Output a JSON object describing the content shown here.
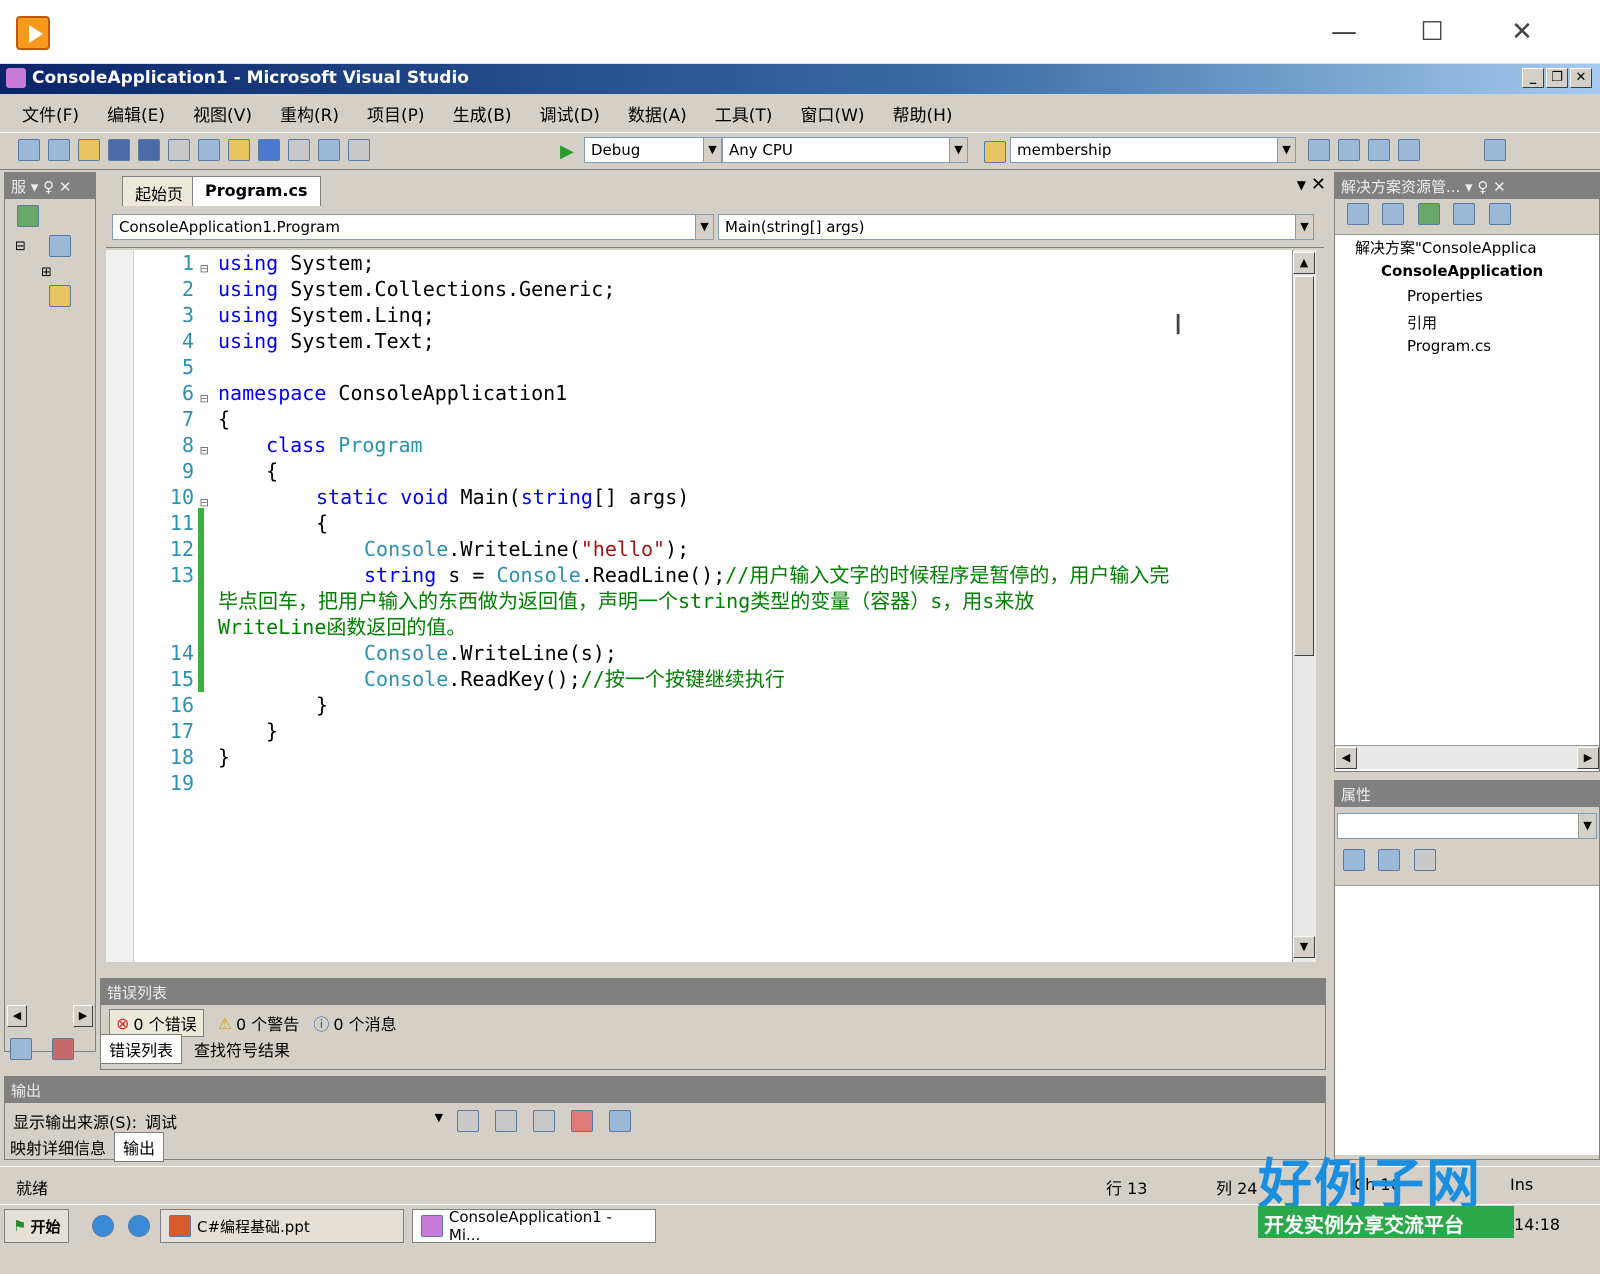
{
  "player": {
    "close_glyph": "✕",
    "max_glyph": "☐",
    "min_glyph": "—"
  },
  "window": {
    "title": "ConsoleApplication1 - Microsoft Visual Studio"
  },
  "menu": [
    "文件(F)",
    "编辑(E)",
    "视图(V)",
    "重构(R)",
    "项目(P)",
    "生成(B)",
    "调试(D)",
    "数据(A)",
    "工具(T)",
    "窗口(W)",
    "帮助(H)"
  ],
  "toolbar": {
    "config": "Debug",
    "platform": "Any CPU",
    "find_combo": "membership"
  },
  "left_panel": {
    "header": "服 ▾ ♀ ✕"
  },
  "tabs": {
    "start": "起始页",
    "active": "Program.cs"
  },
  "nav": {
    "type": "ConsoleApplication1.Program",
    "member": "Main(string[] args)"
  },
  "code": {
    "line_numbers": [
      "1",
      "2",
      "3",
      "4",
      "5",
      "6",
      "7",
      "8",
      "9",
      "10",
      "11",
      "12",
      "13",
      "",
      "",
      "14",
      "15",
      "16",
      "17",
      "18",
      "19"
    ],
    "l1a": "using",
    "l1b": " System;",
    "l2a": "using",
    "l2b": " System.Collections.Generic;",
    "l3a": "using",
    "l3b": " System.Linq;",
    "l4a": "using",
    "l4b": " System.Text;",
    "l6a": "namespace",
    "l6b": " ConsoleApplication1",
    "l7": "{",
    "l8a": "class",
    "l8b": " Program",
    "l9": "{",
    "l10a": "static",
    "l10b": " ",
    "l10c": "void",
    "l10d": " Main(",
    "l10e": "string",
    "l10f": "[] args)",
    "l11": "{",
    "l12a": "Console",
    "l12b": ".WriteLine(",
    "l12c": "\"hello\"",
    "l12d": ");",
    "l13a": "string",
    "l13b": " s = ",
    "l13c": "Console",
    "l13d": ".ReadLine();",
    "l13e": "//用户输入文字的时候程序是暂停的，用户输入完",
    "l13f": "毕点回车，把用户输入的东西做为返回值，声明一个string类型的变量（容器）s，用s来放",
    "l13g": "WriteLine函数返回的值。",
    "l14a": "Console",
    "l14b": ".WriteLine(s);",
    "l15a": "Console",
    "l15b": ".ReadKey();",
    "l15c": "//按一个按键继续执行",
    "l16": "}",
    "l17": "}",
    "l18": "}"
  },
  "solution_explorer": {
    "header": "解决方案资源管... ▾ ♀ ✕",
    "items": [
      "解决方案\"ConsoleApplica",
      "ConsoleApplication",
      "Properties",
      "引用",
      "Program.cs"
    ]
  },
  "properties": {
    "header": "属性"
  },
  "error_list": {
    "header": "错误列表",
    "errors": "0 个错误",
    "warnings": "0 个警告",
    "messages": "0 个消息",
    "tab1": "错误列表",
    "tab2": "查找符号结果"
  },
  "output": {
    "header": "输出",
    "source_label": "显示输出来源(S):",
    "source_value": "调试",
    "tab1": "映射详细信息",
    "tab2": "输出"
  },
  "status": {
    "ready": "就绪",
    "line": "行 13",
    "col": "列 24",
    "ch": "Ch 16",
    "mode": "Ins"
  },
  "taskbar": {
    "start": "开始",
    "task1": "C#编程基础.ppt",
    "task2": "ConsoleApplication1 - Mi...",
    "time": "14:18"
  },
  "watermark": {
    "logo": "好例子网",
    "tagline": "开发实例分享交流平台"
  }
}
